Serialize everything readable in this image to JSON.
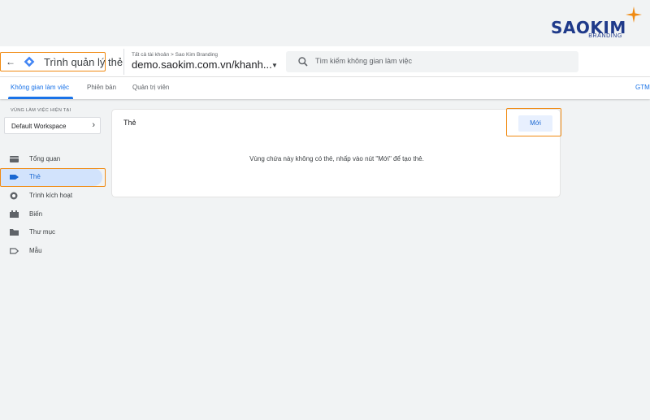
{
  "brand": {
    "name": "SAOKIM",
    "tagline": "BRANDING",
    "star_color": "#f08a12",
    "text_color": "#1f3a8a"
  },
  "topbar": {
    "back_icon": "arrow-left-icon",
    "app_icon": "tag-manager-diamond-icon",
    "app_title": "Trình quản lý thẻ",
    "breadcrumb": "Tất cả tài khoản > Sao Kim Branding",
    "container_name": "demo.saokim.com.vn/khanh...",
    "dropdown_icon": "caret-down-icon",
    "search": {
      "placeholder": "Tìm kiếm không gian làm việc",
      "icon": "search-icon"
    }
  },
  "tabs": [
    {
      "label": "Không gian làm việc",
      "active": true
    },
    {
      "label": "Phiên bản",
      "active": false
    },
    {
      "label": "Quản trị viên",
      "active": false
    },
    {
      "label": "GTM",
      "active": false
    }
  ],
  "sidebar": {
    "workspace_label": "VÙNG LÀM VIỆC HIỆN TẠI",
    "workspace_name": "Default Workspace",
    "items": [
      {
        "label": "Tổng quan",
        "icon": "overview-folder-icon",
        "active": false
      },
      {
        "label": "Thẻ",
        "icon": "tag-icon",
        "active": true
      },
      {
        "label": "Trình kích hoạt",
        "icon": "trigger-icon",
        "active": false
      },
      {
        "label": "Biến",
        "icon": "variables-icon",
        "active": false
      },
      {
        "label": "Thư mục",
        "icon": "folder-icon",
        "active": false
      },
      {
        "label": "Mẫu",
        "icon": "template-icon",
        "active": false
      }
    ]
  },
  "main": {
    "card_title": "Thẻ",
    "new_button": "Mới",
    "empty_message": "Vùng chứa này không có thẻ, nhấp vào nút \"Mới\" để tạo thẻ."
  },
  "colors": {
    "accent": "#1a73e8",
    "highlight": "#f08a12",
    "active_bg": "#d2e3fc"
  }
}
